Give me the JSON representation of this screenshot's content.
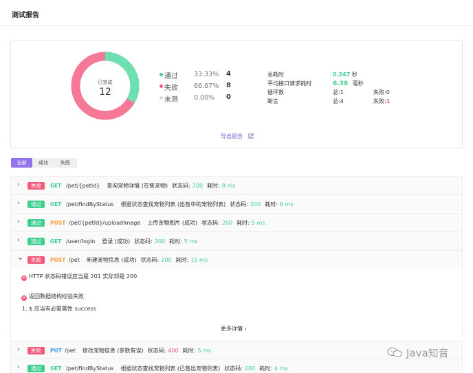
{
  "header": {
    "title": "测试报告"
  },
  "summary": {
    "donut": {
      "label": "已完成",
      "total": "12",
      "pass_fraction": 0.3333,
      "colors": {
        "pass": "#6ddfb0",
        "fail": "#f57897",
        "pending": "#dddddd"
      }
    },
    "legend": [
      {
        "label": "通过",
        "percent": "33.33%",
        "count": "4",
        "color": "#3ecf8e"
      },
      {
        "label": "失败",
        "percent": "66.67%",
        "count": "8",
        "color": "#f45b7b"
      },
      {
        "label": "未测",
        "percent": "0.00%",
        "count": "0",
        "color": "#d8d8d8"
      }
    ],
    "stats": {
      "total_time_label": "总耗时",
      "total_time_value": "0.247",
      "total_time_unit": "秒",
      "avg_time_label": "平均接口请求耗时",
      "avg_time_value": "6.38",
      "avg_time_unit": "毫秒",
      "loops_label": "循环数",
      "loops_total": "总:1",
      "loops_fail_label": "失败:",
      "loops_fail": "0",
      "assert_label": "断言",
      "assert_total": "总:4",
      "assert_fail_label": "失败:",
      "assert_fail": "1"
    },
    "export_label": "导出报告"
  },
  "filters": {
    "all": "全部",
    "success": "成功",
    "fail": "失败"
  },
  "labels": {
    "status_code": "状态码:",
    "time_cost": "耗时:"
  },
  "rows": [
    {
      "result": "失败",
      "method": "GET",
      "path": "/pet/{petId}",
      "desc": "查询宠物详情 (在售宠物)",
      "code": "200",
      "time": "8 ms"
    },
    {
      "result": "通过",
      "method": "GET",
      "path": "/pet/findByStatus",
      "desc": "根据状态查找宠物列表 (出售中的宠物列表)",
      "code": "200",
      "time": "6 ms"
    },
    {
      "result": "通过",
      "method": "POST",
      "path": "/pet/{petId}/uploadImage",
      "desc": "上传宠物图片 (成功)",
      "code": "200",
      "time": "5 ms"
    },
    {
      "result": "通过",
      "method": "GET",
      "path": "/user/login",
      "desc": "登录 (成功)",
      "code": "200",
      "time": "5 ms"
    },
    {
      "result": "失败",
      "method": "POST",
      "path": "/pet",
      "desc": "新建宠物信息 (成功)",
      "code": "200",
      "time": "15 ms"
    },
    {
      "result": "失败",
      "method": "PUT",
      "path": "/pet",
      "desc": "修改宠物信息 (参数有误)",
      "code": "400",
      "time": "5 ms"
    },
    {
      "result": "通过",
      "method": "GET",
      "path": "/pet/findByStatus",
      "desc": "根据状态查找宠物列表 (已售出宠物列表)",
      "code": "200",
      "time": "4 ms"
    }
  ],
  "detail": {
    "error1": "HTTP 状态码错误应当是 201 实际却是 200",
    "error2": "返回数据结构校验失败",
    "error2_sub": "1. $ 应当有必需属性 success",
    "more": "更多详情"
  },
  "watermark": "Java知音"
}
